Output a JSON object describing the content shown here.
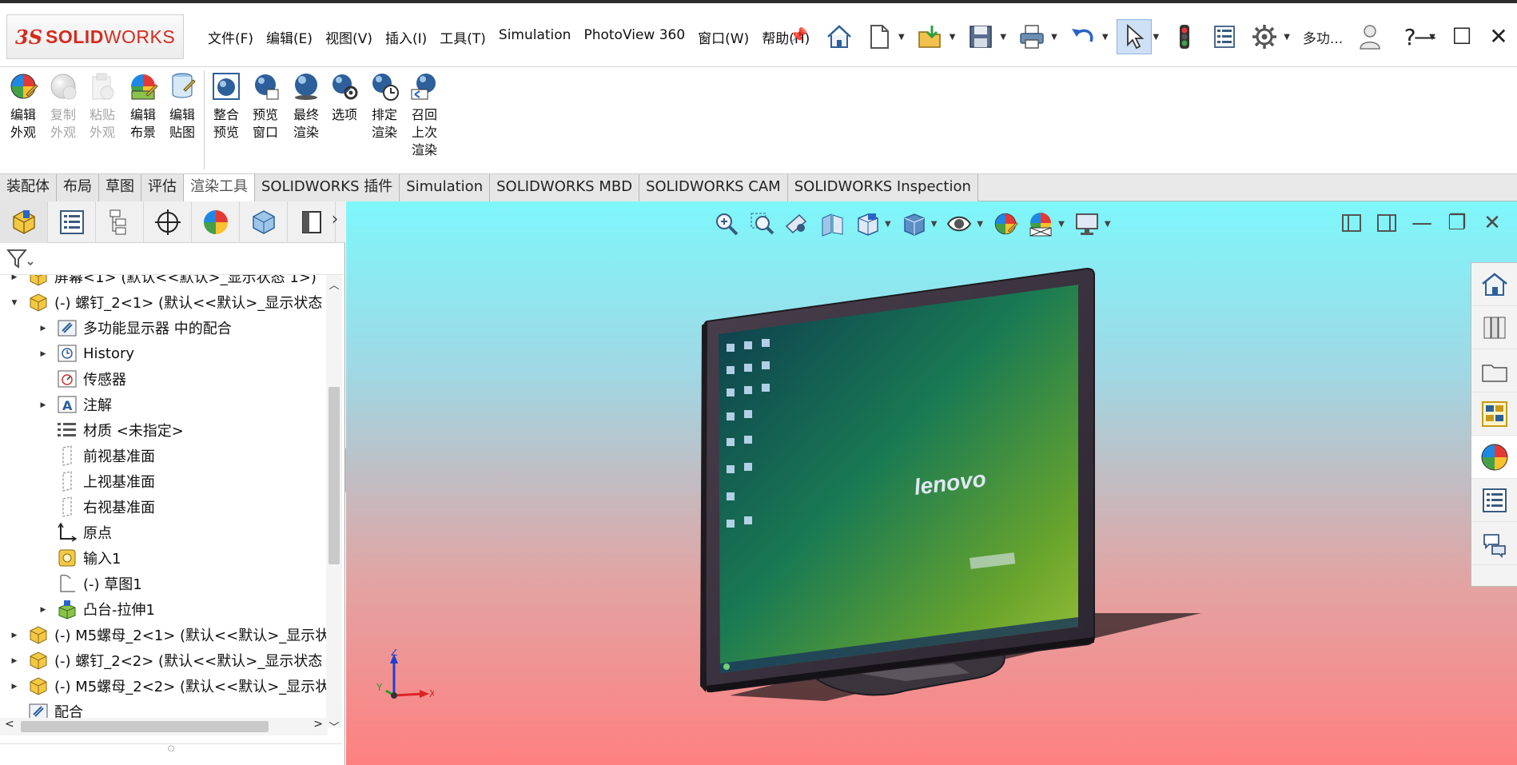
{
  "app": {
    "logo_prefix": "3S",
    "logo_text_a": "SOLID",
    "logo_text_b": "WORKS",
    "brand_color": "#d52b1e"
  },
  "menu": {
    "items": [
      "文件(F)",
      "编辑(E)",
      "视图(V)",
      "插入(I)",
      "工具(T)",
      "Simulation",
      "PhotoView 360",
      "窗口(W)",
      "帮助(H)"
    ]
  },
  "title_tools": {
    "icons": [
      "home-icon",
      "new-document-icon",
      "open-icon",
      "save-icon",
      "print-icon",
      "undo-icon",
      "select-pointer-icon",
      "traffic-light-icon",
      "file-properties-icon",
      "options-gear-icon"
    ],
    "multi_label": "多功...",
    "user_icon": "user-icon",
    "help_label": "?"
  },
  "ribbon": {
    "buttons": [
      {
        "label": "编辑\n外观",
        "icon": "edit-appearance-icon",
        "enabled": true
      },
      {
        "label": "复制\n外观",
        "icon": "copy-appearance-icon",
        "enabled": false
      },
      {
        "label": "粘贴\n外观",
        "icon": "paste-appearance-icon",
        "enabled": false
      },
      {
        "label": "编辑\n布景",
        "icon": "edit-scene-icon",
        "enabled": true
      },
      {
        "label": "编辑\n贴图",
        "icon": "edit-decal-icon",
        "enabled": true
      },
      {
        "label": "整合\n预览",
        "icon": "integrated-preview-icon",
        "enabled": true
      },
      {
        "label": "预览\n窗口",
        "icon": "preview-window-icon",
        "enabled": true
      },
      {
        "label": "最终\n渲染",
        "icon": "final-render-icon",
        "enabled": true
      },
      {
        "label": "选项",
        "icon": "options-icon",
        "enabled": true
      },
      {
        "label": "排定\n渲染",
        "icon": "schedule-render-icon",
        "enabled": true
      },
      {
        "label": "召回\n上次\n渲染",
        "icon": "recall-render-icon",
        "enabled": true
      }
    ]
  },
  "tabs": [
    {
      "label": "装配体",
      "active": false
    },
    {
      "label": "布局",
      "active": false
    },
    {
      "label": "草图",
      "active": false
    },
    {
      "label": "评估",
      "active": false
    },
    {
      "label": "渲染工具",
      "active": true
    },
    {
      "label": "SOLIDWORKS 插件",
      "active": false
    },
    {
      "label": "Simulation",
      "active": false
    },
    {
      "label": "SOLIDWORKS MBD",
      "active": false
    },
    {
      "label": "SOLIDWORKS CAM",
      "active": false
    },
    {
      "label": "SOLIDWORKS Inspection",
      "active": false
    }
  ],
  "panel_tabs": [
    "featuremanager-icon",
    "propertymanager-icon",
    "configurationmanager-icon",
    "dimxpert-icon",
    "displaymanager-icon",
    "cam-feature-icon",
    "cam-operation-icon"
  ],
  "tree": [
    {
      "label": "屏幕<1> (默认<<默认>_显示状态 1>)",
      "level": 0,
      "arrow": "right",
      "icon": "part-icon"
    },
    {
      "label": "(-) 螺钉_2<1> (默认<<默认>_显示状态 1",
      "level": 0,
      "arrow": "down",
      "icon": "part-icon"
    },
    {
      "label": "多功能显示器 中的配合",
      "level": 1,
      "arrow": "right",
      "icon": "mates-icon"
    },
    {
      "label": "History",
      "level": 1,
      "arrow": "right",
      "icon": "history-icon"
    },
    {
      "label": "传感器",
      "level": 1,
      "arrow": "",
      "icon": "sensor-icon"
    },
    {
      "label": "注解",
      "level": 1,
      "arrow": "right",
      "icon": "annotation-icon"
    },
    {
      "label": "材质 <未指定>",
      "level": 1,
      "arrow": "",
      "icon": "material-icon"
    },
    {
      "label": "前视基准面",
      "level": 1,
      "arrow": "",
      "icon": "plane-icon"
    },
    {
      "label": "上视基准面",
      "level": 1,
      "arrow": "",
      "icon": "plane-icon"
    },
    {
      "label": "右视基准面",
      "level": 1,
      "arrow": "",
      "icon": "plane-icon"
    },
    {
      "label": "原点",
      "level": 1,
      "arrow": "",
      "icon": "origin-icon"
    },
    {
      "label": "输入1",
      "level": 1,
      "arrow": "",
      "icon": "imported-body-icon"
    },
    {
      "label": "(-) 草图1",
      "level": 1,
      "arrow": "",
      "icon": "sketch-icon"
    },
    {
      "label": "凸台-拉伸1",
      "level": 1,
      "arrow": "right",
      "icon": "extrude-icon"
    },
    {
      "label": "(-) M5螺母_2<1> (默认<<默认>_显示状",
      "level": 0,
      "arrow": "right",
      "icon": "part-icon"
    },
    {
      "label": "(-) 螺钉_2<2> (默认<<默认>_显示状态 1",
      "level": 0,
      "arrow": "right",
      "icon": "part-icon"
    },
    {
      "label": "(-) M5螺母_2<2> (默认<<默认>_显示状",
      "level": 0,
      "arrow": "right",
      "icon": "part-icon"
    },
    {
      "label": "配合",
      "level": 0,
      "arrow": "",
      "icon": "mates-icon"
    }
  ],
  "viewport": {
    "heads_up_icons": [
      "zoom-to-fit-icon",
      "zoom-to-area-icon",
      "previous-view-icon",
      "section-view-icon",
      "view-orientation-icon",
      "display-style-icon",
      "hide-show-icon",
      "edit-appearance-icon",
      "apply-scene-icon",
      "view-settings-icon"
    ],
    "screen_brand": "lenovo",
    "triad": {
      "x": "X",
      "y": "Y",
      "z": "Z"
    },
    "bg_top": "#7ef7fb",
    "bg_bottom": "#ff8080"
  },
  "taskpane": [
    "solidworks-resources-icon",
    "design-library-icon",
    "file-explorer-icon",
    "view-palette-icon",
    "appearances-scenes-icon",
    "custom-properties-icon",
    "forum-icon"
  ]
}
